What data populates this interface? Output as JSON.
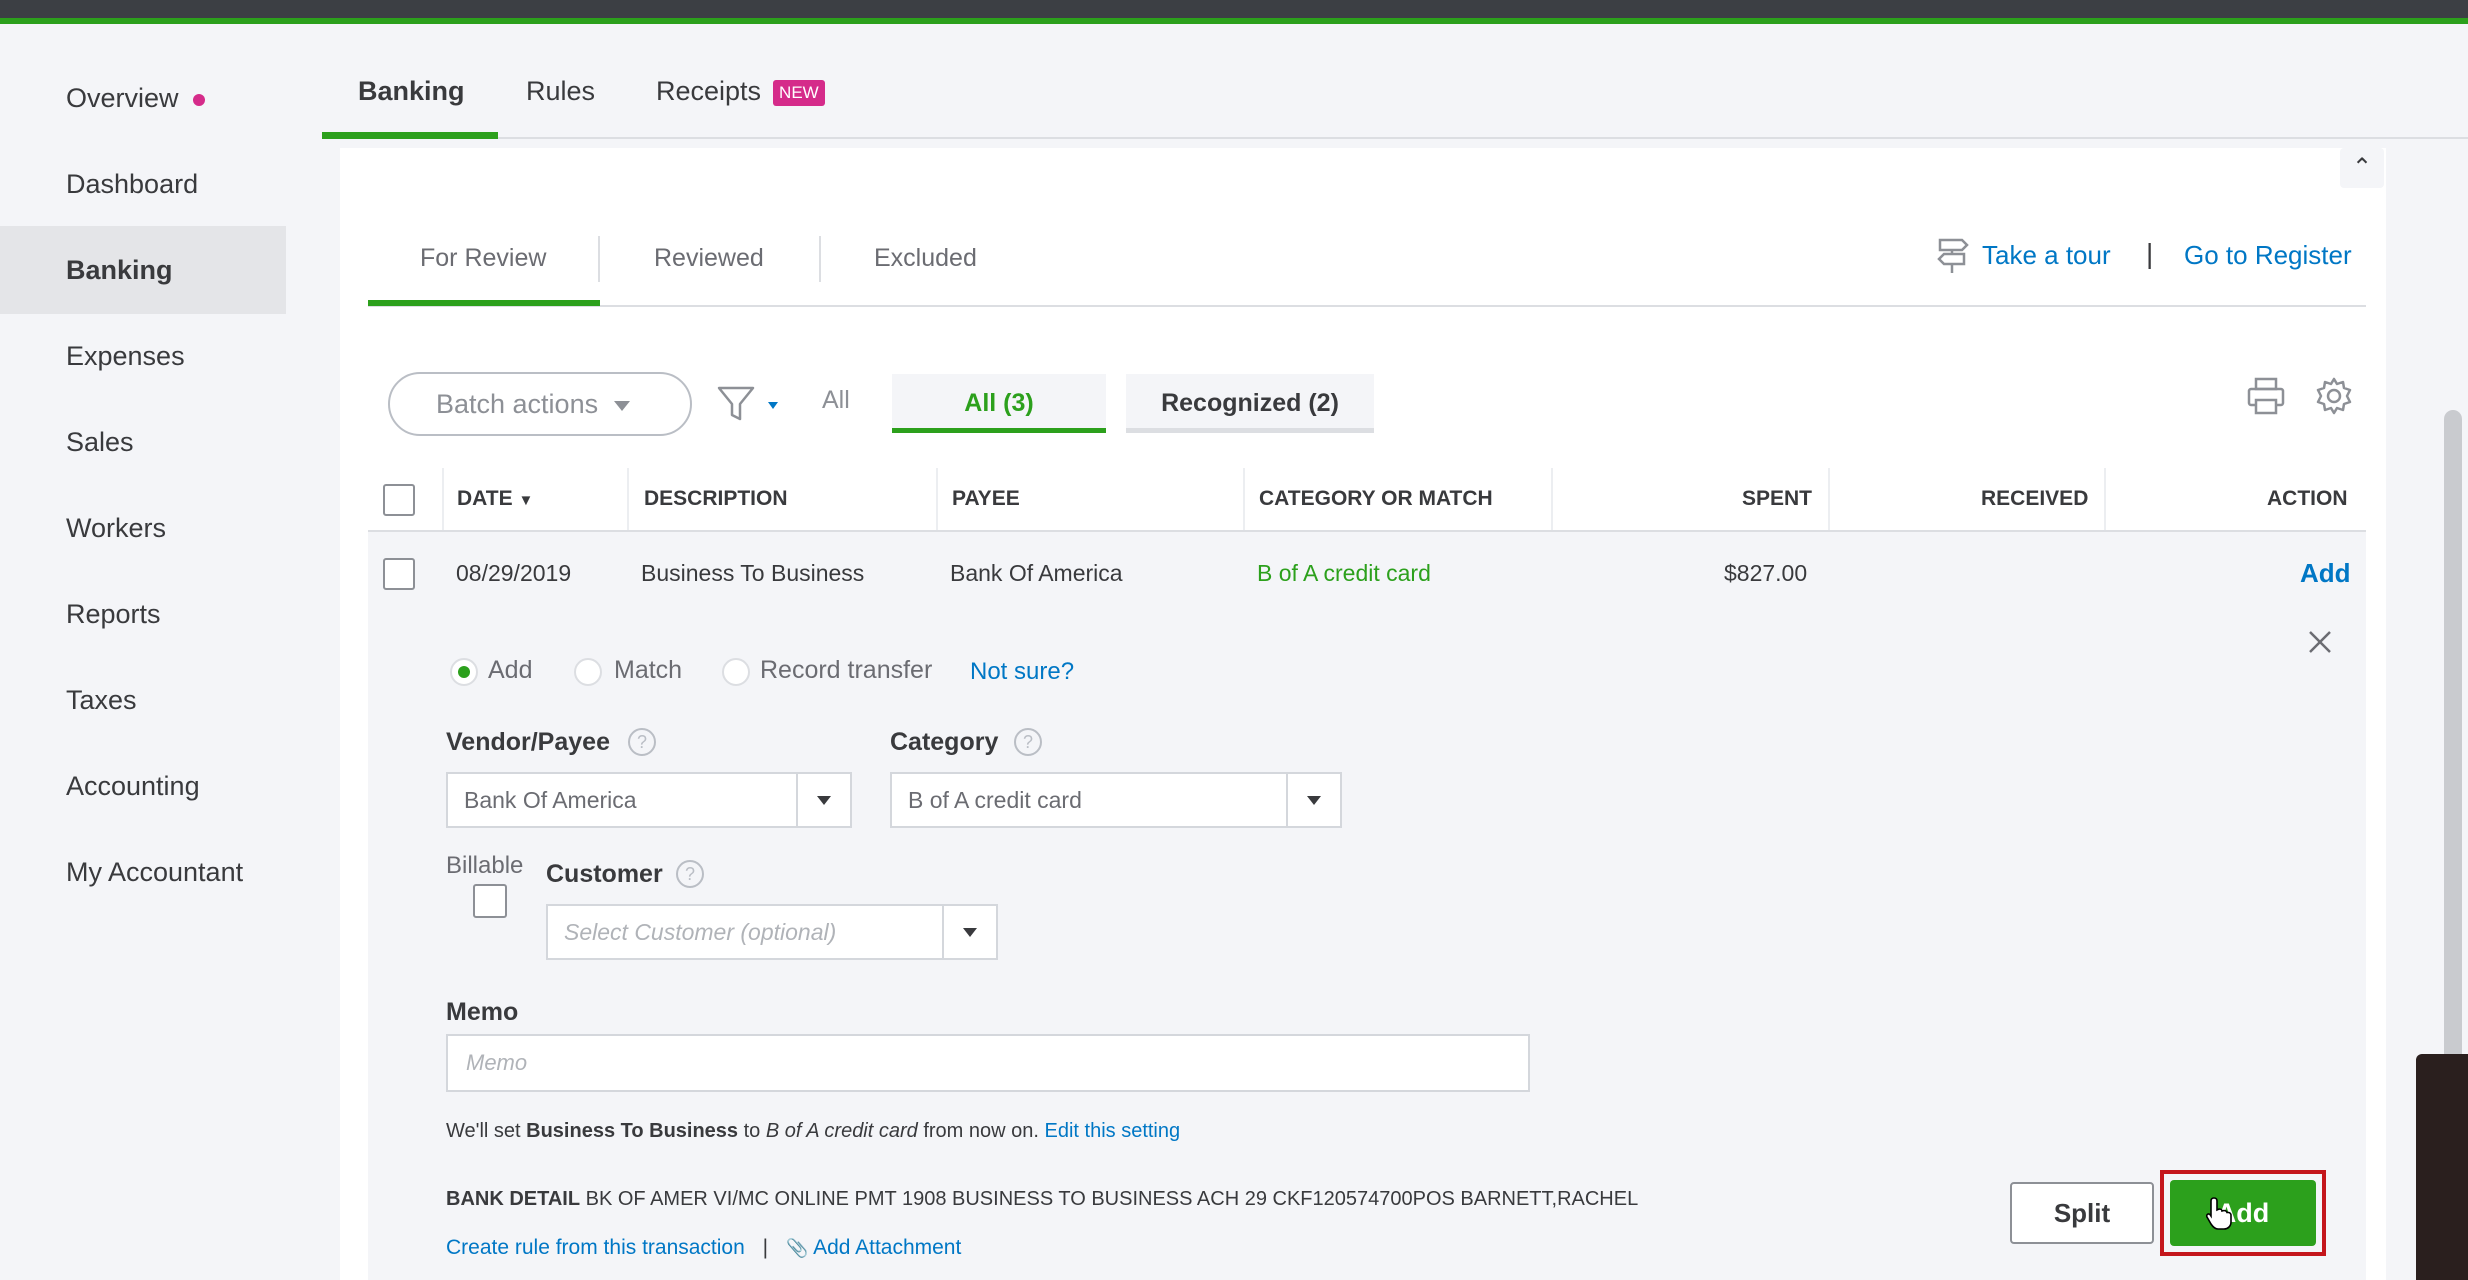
{
  "sidebar": {
    "items": [
      {
        "label": "Overview"
      },
      {
        "label": "Dashboard"
      },
      {
        "label": "Banking"
      },
      {
        "label": "Expenses"
      },
      {
        "label": "Sales"
      },
      {
        "label": "Workers"
      },
      {
        "label": "Reports"
      },
      {
        "label": "Taxes"
      },
      {
        "label": "Accounting"
      },
      {
        "label": "My Accountant"
      }
    ],
    "active": "Banking"
  },
  "top_tabs": {
    "banking": "Banking",
    "rules": "Rules",
    "receipts": "Receipts",
    "receipts_badge": "NEW"
  },
  "sub_tabs": {
    "for_review": "For Review",
    "reviewed": "Reviewed",
    "excluded": "Excluded"
  },
  "links": {
    "take_tour": "Take a tour",
    "separator": "|",
    "go_to_register": "Go to Register"
  },
  "toolbar": {
    "batch_actions": "Batch actions",
    "all": "All",
    "all_count": "All (3)",
    "recognized": "Recognized (2)"
  },
  "table": {
    "headers": {
      "date": "DATE",
      "description": "DESCRIPTION",
      "payee": "PAYEE",
      "category": "CATEGORY OR MATCH",
      "spent": "SPENT",
      "received": "RECEIVED",
      "action": "ACTION"
    },
    "rows": [
      {
        "date": "08/29/2019",
        "description": "Business To Business",
        "payee": "Bank Of America",
        "category": "B of A credit card",
        "spent": "$827.00",
        "received": "",
        "action": "Add"
      }
    ]
  },
  "detail": {
    "radio_add": "Add",
    "radio_match": "Match",
    "radio_transfer": "Record transfer",
    "not_sure": "Not sure?",
    "vendor_label": "Vendor/Payee",
    "vendor_value": "Bank Of America",
    "category_label": "Category",
    "category_value": "B of A credit card",
    "billable_label": "Billable",
    "customer_label": "Customer",
    "customer_placeholder": "Select Customer (optional)",
    "memo_label": "Memo",
    "memo_placeholder": "Memo",
    "note_prefix": "We'll set ",
    "note_bold": "Business To Business",
    "note_mid": " to ",
    "note_italic": "B of A credit card",
    "note_suffix": " from now on. ",
    "note_link": "Edit this setting",
    "bank_detail_label": "BANK DETAIL",
    "bank_detail_text": " BK OF AMER VI/MC ONLINE PMT 1908 BUSINESS TO BUSINESS ACH 29 CKF120574700POS BARNETT,RACHEL",
    "create_rule": "Create rule from this transaction",
    "link_separator": "|",
    "add_attachment": "Add Attachment",
    "split_button": "Split",
    "add_button": "Add"
  },
  "colors": {
    "brand_green": "#2ca01c",
    "link_blue": "#0077c5",
    "badge_pink": "#d52b8a",
    "highlight_red": "#c4161c"
  }
}
